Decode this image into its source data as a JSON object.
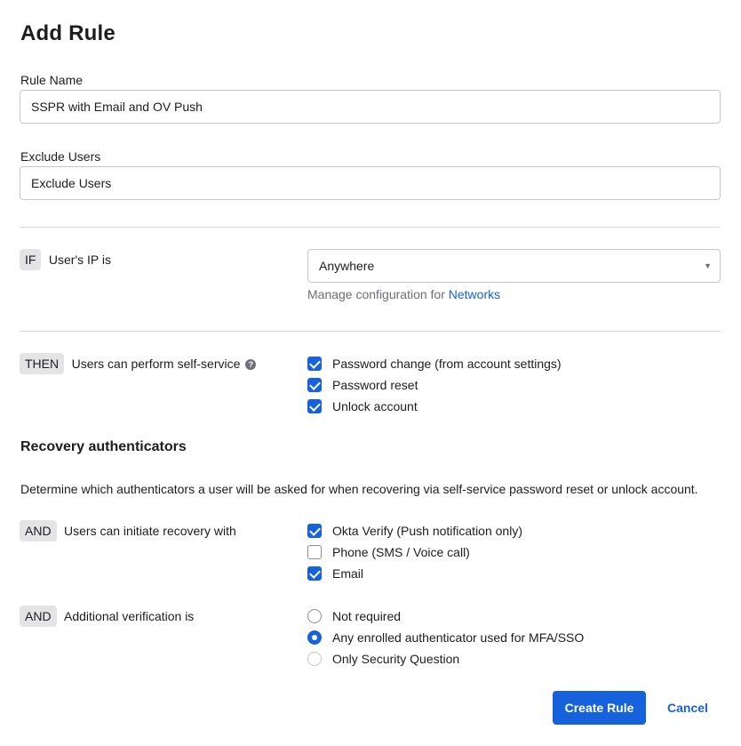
{
  "page": {
    "title": "Add Rule"
  },
  "rule_name": {
    "label": "Rule Name",
    "value": "SSPR with Email and OV Push"
  },
  "exclude_users": {
    "label": "Exclude Users",
    "placeholder": "Exclude Users"
  },
  "if_condition": {
    "tag": "IF",
    "text": "User's IP is",
    "select_value": "Anywhere",
    "help_text": "Manage configuration for ",
    "help_link": "Networks"
  },
  "then_condition": {
    "tag": "THEN",
    "text": "Users can perform self-service",
    "help_icon": "question-icon",
    "options": [
      {
        "label": "Password change (from account settings)",
        "checked": true
      },
      {
        "label": "Password reset",
        "checked": true
      },
      {
        "label": "Unlock account",
        "checked": true
      }
    ]
  },
  "recovery": {
    "title": "Recovery authenticators",
    "description": "Determine which authenticators a user will be asked for when recovering via self-service password reset or unlock account."
  },
  "and_recovery": {
    "tag": "AND",
    "text": "Users can initiate recovery with",
    "options": [
      {
        "label": "Okta Verify (Push notification only)",
        "checked": true
      },
      {
        "label": "Phone (SMS / Voice call)",
        "checked": false
      },
      {
        "label": "Email",
        "checked": true
      }
    ]
  },
  "and_verification": {
    "tag": "AND",
    "text": "Additional verification is",
    "options": [
      {
        "label": "Not required",
        "selected": false
      },
      {
        "label": "Any enrolled authenticator used for MFA/SSO",
        "selected": true
      },
      {
        "label": "Only Security Question",
        "selected": false,
        "disabled": true
      }
    ]
  },
  "actions": {
    "create_label": "Create Rule",
    "cancel_label": "Cancel"
  },
  "colors": {
    "accent": "#1662dd",
    "tag_bg": "#e4e4e7",
    "border": "#c8c8cc"
  }
}
